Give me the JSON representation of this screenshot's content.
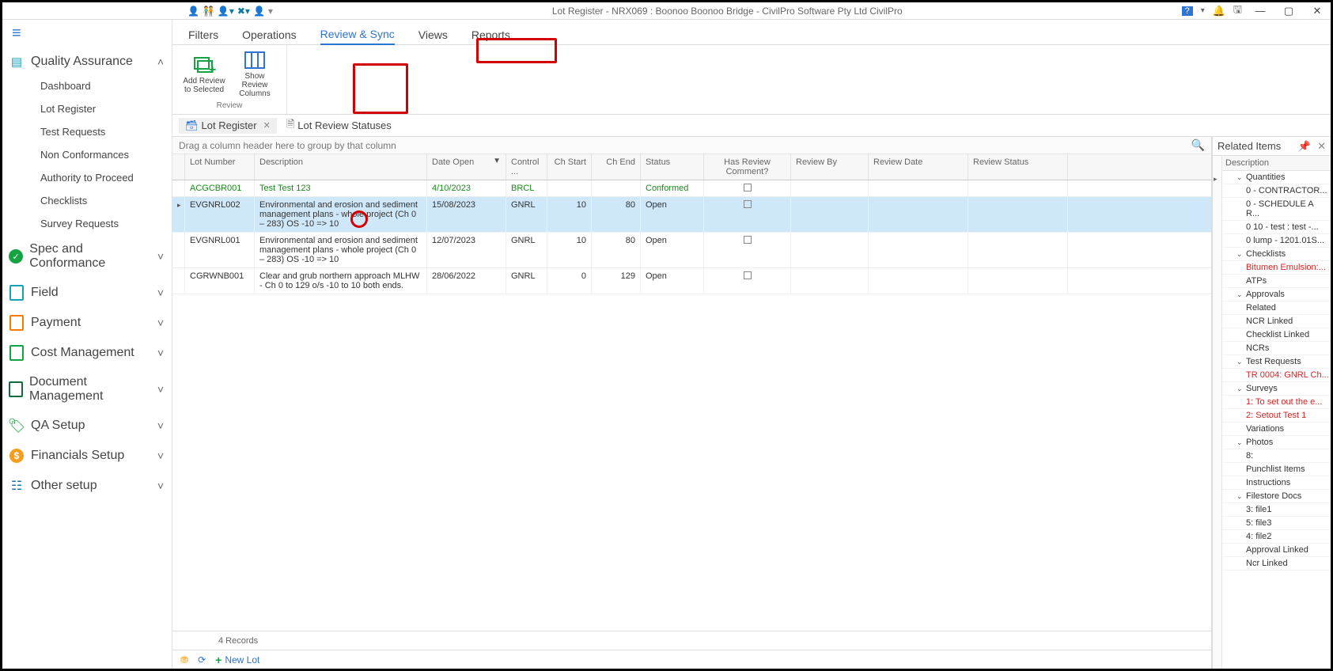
{
  "titlebar": {
    "title": "Lot Register - NRX069 : Boonoo Boonoo Bridge - CivilPro Software Pty Ltd CivilPro",
    "help_icon": "?",
    "bell_icon": "🔔"
  },
  "sidebar": {
    "qa": {
      "label": "Quality Assurance",
      "items": [
        "Dashboard",
        "Lot Register",
        "Test Requests",
        "Non Conformances",
        "Authority to Proceed",
        "Checklists",
        "Survey Requests"
      ]
    },
    "groups": [
      {
        "label": "Spec and Conformance",
        "icon": "green-check"
      },
      {
        "label": "Field",
        "icon": "teal-file"
      },
      {
        "label": "Payment",
        "icon": "orange-file"
      },
      {
        "label": "Cost Management",
        "icon": "green-file"
      },
      {
        "label": "Document Management",
        "icon": "dark-file"
      },
      {
        "label": "QA Setup",
        "icon": "green-tag"
      },
      {
        "label": "Financials Setup",
        "icon": "orange-dollar"
      },
      {
        "label": "Other setup",
        "icon": "blue-gear"
      }
    ]
  },
  "menu_tabs": [
    "Filters",
    "Operations",
    "Review & Sync",
    "Views",
    "Reports"
  ],
  "menu_active": "Review & Sync",
  "ribbon": {
    "group_title": "Review",
    "btn1": "Add Review to Selected",
    "btn2": "Show Review Columns"
  },
  "subtabs": {
    "tab1": "Lot Register",
    "tab2": "Lot Review Statuses"
  },
  "grid": {
    "group_hint": "Drag a column header here to group by that column",
    "columns": [
      "Lot Number",
      "Description",
      "Date Open",
      "Control ...",
      "Ch Start",
      "Ch End",
      "Status",
      "Has Review Comment?",
      "Review By",
      "Review Date",
      "Review Status"
    ],
    "rows": [
      {
        "lot": "ACGCBR001",
        "desc": "Test Test 123",
        "date": "4/10/2023",
        "ctrl": "BRCL",
        "chs": "",
        "che": "",
        "status": "Conformed",
        "style": "green"
      },
      {
        "lot": "EVGNRL002",
        "desc": "Environmental and erosion and sediment management plans - whole project (Ch 0 – 283) OS -10 => 10",
        "date": "15/08/2023",
        "ctrl": "GNRL",
        "chs": "10",
        "che": "80",
        "status": "Open",
        "style": "selected"
      },
      {
        "lot": "EVGNRL001",
        "desc": "Environmental and erosion and sediment management plans - whole project (Ch 0 – 283) OS -10 => 10",
        "date": "12/07/2023",
        "ctrl": "GNRL",
        "chs": "10",
        "che": "80",
        "status": "Open",
        "style": ""
      },
      {
        "lot": "CGRWNB001",
        "desc": "Clear and grub northern approach MLHW - Ch 0 to 129  o/s -10 to 10 both ends.",
        "date": "28/06/2022",
        "ctrl": "GNRL",
        "chs": "0",
        "che": "129",
        "status": "Open",
        "style": ""
      }
    ],
    "record_summary": "4 Records",
    "new_lot": "New Lot"
  },
  "related": {
    "title": "Related Items",
    "desc_header": "Description",
    "groups": [
      {
        "label": "Quantities",
        "items": [
          {
            "t": "0  - CONTRACTOR..."
          },
          {
            "t": "0  - SCHEDULE A R..."
          },
          {
            "t": "0 10 - test : test  -..."
          },
          {
            "t": "0 lump - 1201.01S..."
          }
        ]
      },
      {
        "label": "Checklists",
        "items": [
          {
            "t": "Bitumen Emulsion:...",
            "red": true
          }
        ]
      },
      {
        "label": "ATPs",
        "flat": true
      },
      {
        "label": "Approvals",
        "items": [
          {
            "t": "Related"
          },
          {
            "t": "NCR Linked"
          },
          {
            "t": "Checklist Linked"
          }
        ]
      },
      {
        "label": "NCRs",
        "flat": true
      },
      {
        "label": "Test Requests",
        "items": [
          {
            "t": "TR 0004: GNRL Ch...",
            "red": true
          }
        ]
      },
      {
        "label": "Surveys",
        "items": [
          {
            "t": "1: To set out the e...",
            "red": true
          },
          {
            "t": "2: Setout Test 1",
            "red": true
          }
        ]
      },
      {
        "label": "Variations",
        "flat": true
      },
      {
        "label": "Photos",
        "items": [
          {
            "t": "8:"
          }
        ]
      },
      {
        "label": "Punchlist Items",
        "flat": true
      },
      {
        "label": "Instructions",
        "flat": true
      },
      {
        "label": "Filestore Docs",
        "items": [
          {
            "t": "3: file1"
          },
          {
            "t": "5: file3"
          },
          {
            "t": "4: file2"
          },
          {
            "t": "Approval Linked"
          },
          {
            "t": "Ncr Linked"
          }
        ]
      }
    ]
  }
}
